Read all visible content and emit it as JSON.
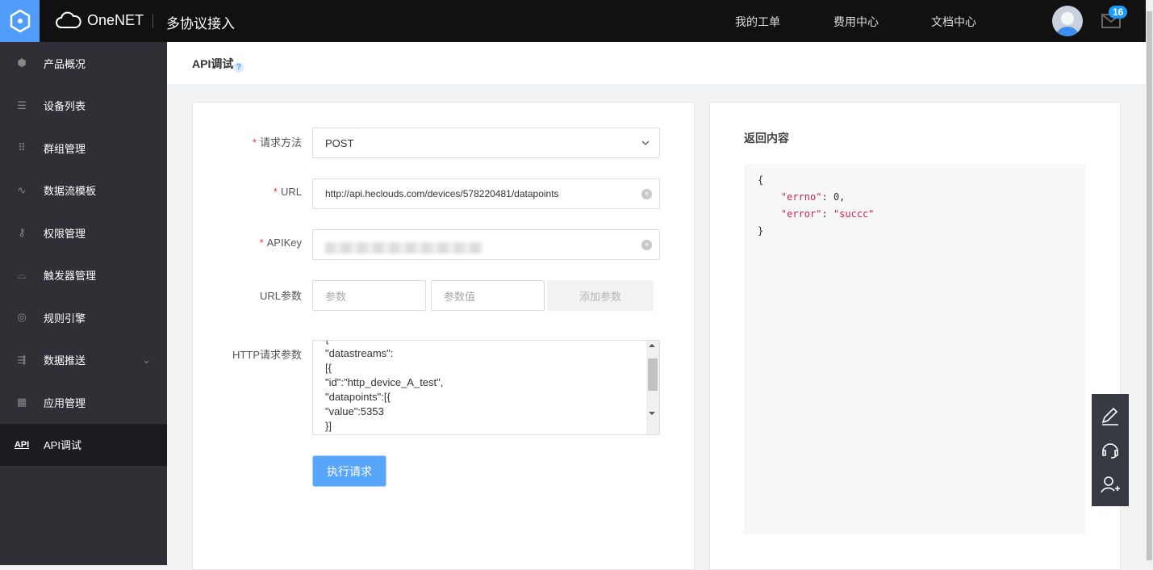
{
  "header": {
    "brand": "OneNET",
    "product": "多协议接入",
    "nav": [
      "我的工单",
      "费用中心",
      "文档中心"
    ],
    "mail_count": "16"
  },
  "sidebar": {
    "items": [
      {
        "label": "产品概况",
        "icon": "cube-icon"
      },
      {
        "label": "设备列表",
        "icon": "list-icon"
      },
      {
        "label": "群组管理",
        "icon": "grid-dots-icon"
      },
      {
        "label": "数据流模板",
        "icon": "stream-icon"
      },
      {
        "label": "权限管理",
        "icon": "key-icon"
      },
      {
        "label": "触发器管理",
        "icon": "trigger-icon"
      },
      {
        "label": "规则引擎",
        "icon": "rule-icon"
      },
      {
        "label": "数据推送",
        "icon": "push-icon"
      },
      {
        "label": "应用管理",
        "icon": "apps-icon"
      },
      {
        "label": "API调试",
        "icon": "api-icon",
        "active": true
      }
    ]
  },
  "page": {
    "title": "API调试",
    "help": "?"
  },
  "form": {
    "method_label": "请求方法",
    "method_value": "POST",
    "url_label": "URL",
    "url_value": "http://api.heclouds.com/devices/578220481/datapoints",
    "apikey_label": "APIKey",
    "params_label": "URL参数",
    "param_placeholder": "参数",
    "value_placeholder": "参数值",
    "add_param": "添加参数",
    "body_label": "HTTP请求参数",
    "body_value": "{\n\"datastreams\":\n[{\n\"id\":\"http_device_A_test\",\n\"datapoints\":[{\n\"value\":5353\n}]",
    "submit": "执行请求"
  },
  "response": {
    "title": "返回内容",
    "errno_key": "\"errno\"",
    "errno_val": "0",
    "error_key": "\"error\"",
    "error_val": "\"succc\""
  },
  "colors": {
    "accent": "#4f9cf9",
    "sidebar": "#2f2f35",
    "header": "#111111"
  }
}
